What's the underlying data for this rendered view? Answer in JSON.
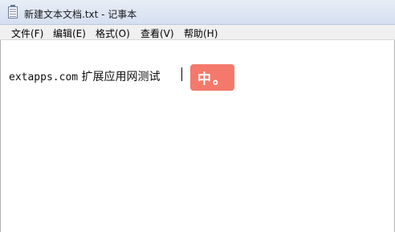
{
  "window": {
    "title": "新建文本文档.txt - 记事本"
  },
  "menu": {
    "file": "文件(F)",
    "edit": "编辑(E)",
    "format": "格式(O)",
    "view": "查看(V)",
    "help": "帮助(H)"
  },
  "editor": {
    "text_latin": "extapps.com",
    "text_cjk": " 扩展应用网测试"
  },
  "ime": {
    "mode": "中",
    "punct": "。",
    "color": "#f4796b"
  },
  "icons": {
    "app": "notepad-icon"
  }
}
